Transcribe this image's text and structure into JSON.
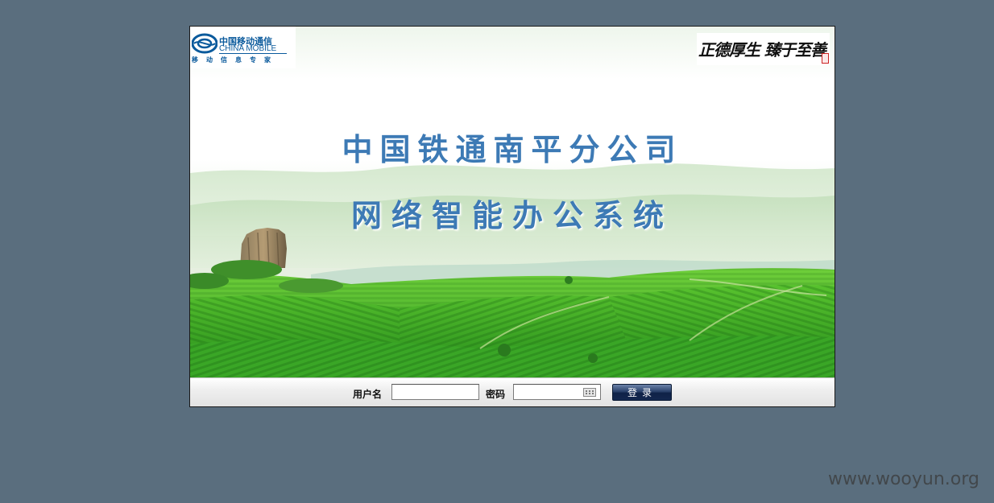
{
  "banner": {
    "logo": {
      "name_cn": "中国移动通信",
      "name_en": "CHINA MOBILE",
      "slogan": "移动信息专家"
    },
    "motto": "正德厚生  臻于至善",
    "title_line1": "中国铁通南平分公司",
    "title_line2": "网络智能办公系统"
  },
  "login": {
    "username_label": "用户名",
    "username_value": "",
    "password_label": "密码",
    "password_value": "",
    "submit_label": "登录"
  },
  "watermark": "www.wooyun.org",
  "colors": {
    "page_background": "#5a6e7e",
    "title_blue": "#3d7ab5",
    "field_green": "#3fae2f",
    "button_navy": "#14284f"
  }
}
